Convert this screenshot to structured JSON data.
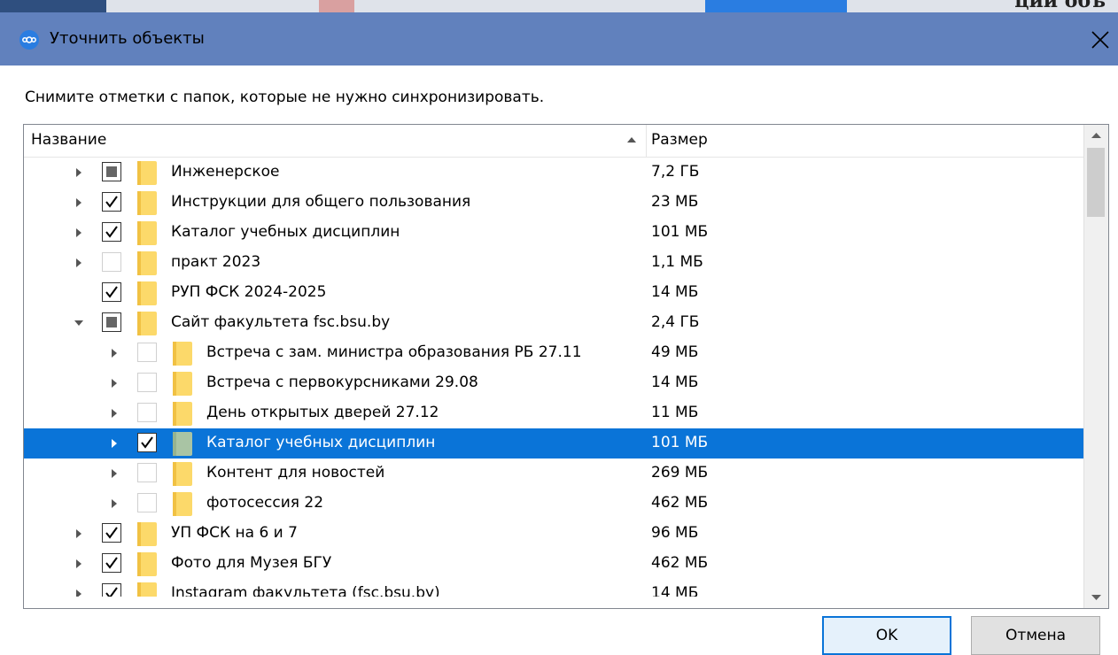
{
  "window": {
    "title": "Уточнить объекты",
    "colors": {
      "titlebar": "#6181bd",
      "selection": "#0a74d8",
      "folder": "#fcd96a"
    }
  },
  "instruction": "Снимите отметки с папок, которые не нужно синхронизировать.",
  "tree": {
    "columns": {
      "name": "Название",
      "size": "Размер"
    },
    "rows": [
      {
        "name": "Инженерское",
        "size": "7,2 ГБ",
        "level": 0,
        "expander": "collapsed",
        "check": "partial",
        "selected": false
      },
      {
        "name": "Инструкции для общего пользования",
        "size": "23 МБ",
        "level": 0,
        "expander": "collapsed",
        "check": "checked",
        "selected": false
      },
      {
        "name": "Каталог учебных дисциплин",
        "size": "101 МБ",
        "level": 0,
        "expander": "collapsed",
        "check": "checked",
        "selected": false
      },
      {
        "name": "практ 2023",
        "size": "1,1 МБ",
        "level": 0,
        "expander": "collapsed",
        "check": "unchecked",
        "selected": false
      },
      {
        "name": "РУП ФСК 2024-2025",
        "size": "14 МБ",
        "level": 0,
        "expander": "none",
        "check": "checked",
        "selected": false
      },
      {
        "name": "Сайт факультета fsc.bsu.by",
        "size": "2,4 ГБ",
        "level": 0,
        "expander": "expanded",
        "check": "partial",
        "selected": false
      },
      {
        "name": "Встреча с зам. министра образования РБ 27.11",
        "size": "49 МБ",
        "level": 1,
        "expander": "collapsed",
        "check": "unchecked",
        "selected": false
      },
      {
        "name": "Встреча с первокурсниками 29.08",
        "size": "14 МБ",
        "level": 1,
        "expander": "collapsed",
        "check": "unchecked",
        "selected": false
      },
      {
        "name": "День открытых дверей 27.12",
        "size": "11 МБ",
        "level": 1,
        "expander": "collapsed",
        "check": "unchecked",
        "selected": false
      },
      {
        "name": "Каталог учебных дисциплин",
        "size": "101 МБ",
        "level": 1,
        "expander": "collapsed",
        "check": "checked",
        "selected": true
      },
      {
        "name": "Контент для новостей",
        "size": "269 МБ",
        "level": 1,
        "expander": "collapsed",
        "check": "unchecked",
        "selected": false
      },
      {
        "name": "фотосессия 22",
        "size": "462 МБ",
        "level": 1,
        "expander": "collapsed",
        "check": "unchecked",
        "selected": false
      },
      {
        "name": "УП ФСК на 6 и 7",
        "size": "96 МБ",
        "level": 0,
        "expander": "collapsed",
        "check": "checked",
        "selected": false
      },
      {
        "name": "Фото для Музея БГУ",
        "size": "462 МБ",
        "level": 0,
        "expander": "collapsed",
        "check": "checked",
        "selected": false
      },
      {
        "name": "Instagram факультета (fsc.bsu.by)",
        "size": "14 МБ",
        "level": 0,
        "expander": "collapsed",
        "check": "checked",
        "selected": false,
        "clipped": true
      }
    ]
  },
  "buttons": {
    "ok": "OK",
    "cancel": "Отмена"
  },
  "icons": {
    "app": "nextcloud-icon",
    "close": "close-icon",
    "sort": "sort-ascending-icon"
  },
  "background_text": "ции объ"
}
